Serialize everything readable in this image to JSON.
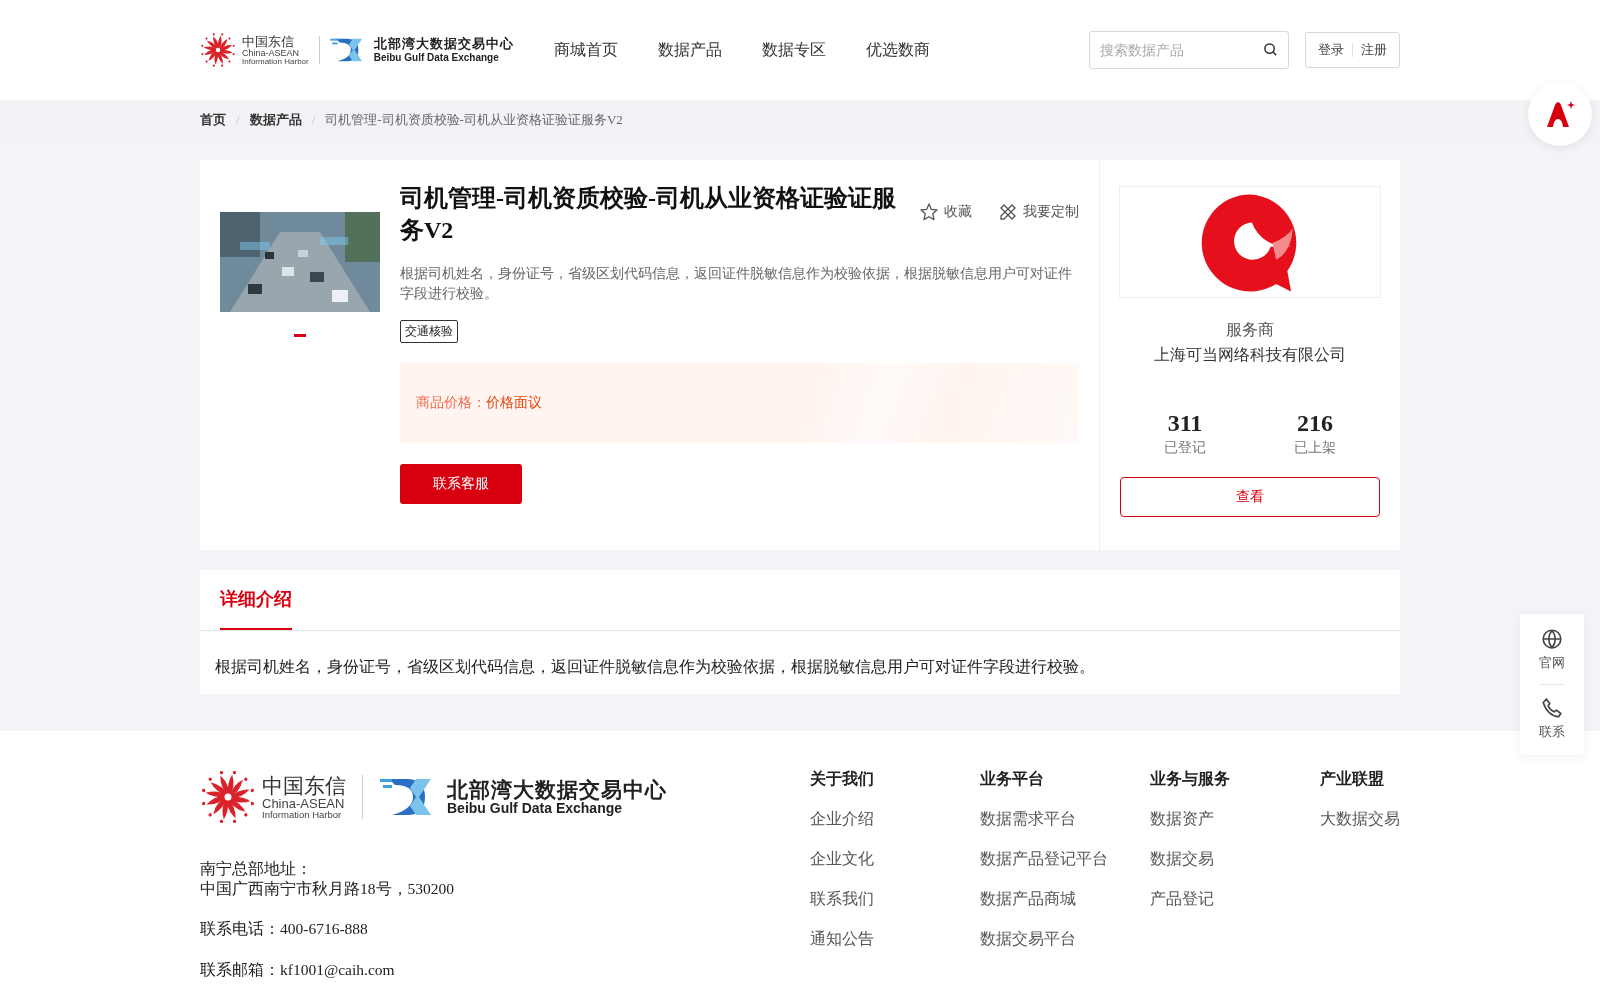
{
  "header": {
    "logo": {
      "brand_cn": "中国东信",
      "brand_en_1": "China-ASEAN",
      "brand_en_2": "Information Harbor",
      "exchange_cn": "北部湾大数据交易中心",
      "exchange_en": "Beibu Gulf Data Exchange"
    },
    "nav": [
      "商城首页",
      "数据产品",
      "数据专区",
      "优选数商"
    ],
    "search": {
      "placeholder": "搜索数据产品"
    },
    "auth": [
      "登录",
      "注册"
    ]
  },
  "breadcrumb": {
    "items": [
      "首页",
      "数据产品",
      "司机管理-司机资质校验-司机从业资格证验证服务V2"
    ],
    "separators": [
      "/",
      "/"
    ]
  },
  "product": {
    "title": "司机管理-司机资质校验-司机从业资格证验证服务V2",
    "actions": [
      {
        "kind": "star",
        "label": "收藏"
      },
      {
        "kind": "pencil",
        "label": "我要定制"
      }
    ],
    "description": "根据司机姓名，身份证号，省级区划代码信息，返回证件脱敏信息作为校验依据，根据脱敏信息用户可对证件字段进行校验。",
    "tags": [
      "交通核验"
    ],
    "carousel_dots": [
      {
        "selected": true
      }
    ],
    "price_label": "商品价格：",
    "price_value": "价格面议",
    "contact_button": "联系客服"
  },
  "provider": {
    "label": "服务商",
    "name": "上海可当网络科技有限公司",
    "stats": [
      {
        "value": "311",
        "label": "已登记"
      },
      {
        "value": "216",
        "label": "已上架"
      }
    ],
    "view_button": "查看"
  },
  "detail": {
    "tabs": [
      {
        "label": "详细介绍",
        "selected": true
      }
    ],
    "text": "根据司机姓名，身份证号，省级区划代码信息，返回证件脱敏信息作为校验依据，根据脱敏信息用户可对证件字段进行校验。"
  },
  "side_tools": [
    {
      "kind": "globe",
      "label": "官网"
    },
    {
      "kind": "phone",
      "label": "联系"
    }
  ],
  "footer": {
    "logo": {
      "brand_cn": "中国东信",
      "brand_en_1": "China-ASEAN",
      "brand_en_2": "Information Harbor",
      "exchange_cn": "北部湾大数据交易中心",
      "exchange_en": "Beibu Gulf Data Exchange"
    },
    "address_label": "南宁总部地址：",
    "address": "中国广西南宁市秋月路18号，530200",
    "phone": "联系电话：400-6716-888",
    "email": "联系邮箱：kf1001@caih.com",
    "columns": [
      {
        "title": "关于我们",
        "links": [
          "企业介绍",
          "企业文化",
          "联系我们",
          "通知公告"
        ]
      },
      {
        "title": "业务平台",
        "links": [
          "数据需求平台",
          "数据产品登记平台",
          "数据产品商城",
          "数据交易平台"
        ]
      },
      {
        "title": "业务与服务",
        "links": [
          "数据资产",
          "数据交易",
          "产品登记"
        ]
      },
      {
        "title": "产业联盟",
        "links": [
          "大数据交易"
        ]
      }
    ]
  }
}
